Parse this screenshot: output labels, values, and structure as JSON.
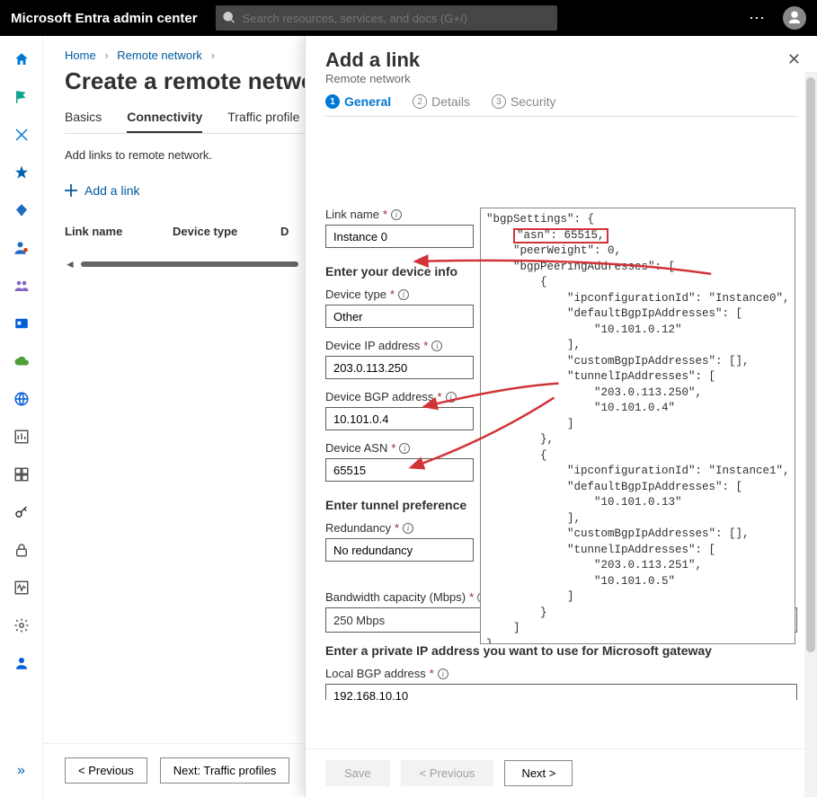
{
  "topbar": {
    "brand": "Microsoft Entra admin center",
    "search_placeholder": "Search resources, services, and docs (G+/)"
  },
  "breadcrumbs": {
    "home": "Home",
    "remote": "Remote network"
  },
  "page_title": "Create a remote network",
  "main_tabs": {
    "basics": "Basics",
    "connectivity": "Connectivity",
    "traffic": "Traffic profile"
  },
  "hint": "Add links to remote network.",
  "add_link": "Add a link",
  "table": {
    "link_name": "Link name",
    "device_type": "Device type",
    "extra": "D"
  },
  "main_footer": {
    "prev": "<  Previous",
    "next": "Next: Traffic profiles"
  },
  "panel": {
    "title": "Add a link",
    "sub": "Remote network",
    "steps": {
      "general": "General",
      "details": "Details",
      "security": "Security"
    },
    "labels": {
      "link_name": "Link name",
      "device_info_head": "Enter your device info",
      "device_type": "Device type",
      "device_ip": "Device IP address",
      "device_bgp": "Device BGP address",
      "device_asn": "Device ASN",
      "tunnel_head": "Enter tunnel preference",
      "redundancy": "Redundancy",
      "bandwidth": "Bandwidth capacity (Mbps)",
      "private_ip_head": "Enter a private IP address you want to use for Microsoft gateway",
      "local_bgp": "Local BGP address"
    },
    "values": {
      "link_name": "Instance 0",
      "device_type": "Other",
      "device_ip": "203.0.113.250",
      "device_bgp": "10.101.0.4",
      "device_asn": "65515",
      "redundancy": "No redundancy",
      "bandwidth": "250 Mbps",
      "local_bgp": "192.168.10.10"
    },
    "footer": {
      "save": "Save",
      "prev": "<  Previous",
      "next": "Next  >"
    }
  },
  "json_overlay": {
    "l1": "\"bgpSettings\": {",
    "asn": "\"asn\": 65515,",
    "l3": "    \"peerWeight\": 0,",
    "l4": "    \"bgpPeeringAddresses\": [",
    "l5": "        {",
    "l6": "            \"ipconfigurationId\": \"Instance0\",",
    "l7": "            \"defaultBgpIpAddresses\": [",
    "l8": "                \"10.101.0.12\"",
    "l9": "            ],",
    "l10": "            \"customBgpIpAddresses\": [],",
    "l11": "            \"tunnelIpAddresses\": [",
    "l12": "                \"203.0.113.250\",",
    "l13": "                \"10.101.0.4\"",
    "l14": "            ]",
    "l15": "        },",
    "l16": "        {",
    "l17": "            \"ipconfigurationId\": \"Instance1\",",
    "l18": "            \"defaultBgpIpAddresses\": [",
    "l19": "                \"10.101.0.13\"",
    "l20": "            ],",
    "l21": "            \"customBgpIpAddresses\": [],",
    "l22": "            \"tunnelIpAddresses\": [",
    "l23": "                \"203.0.113.251\",",
    "l24": "                \"10.101.0.5\"",
    "l25": "            ]",
    "l26": "        }",
    "l27": "    ]",
    "l28": "},"
  }
}
